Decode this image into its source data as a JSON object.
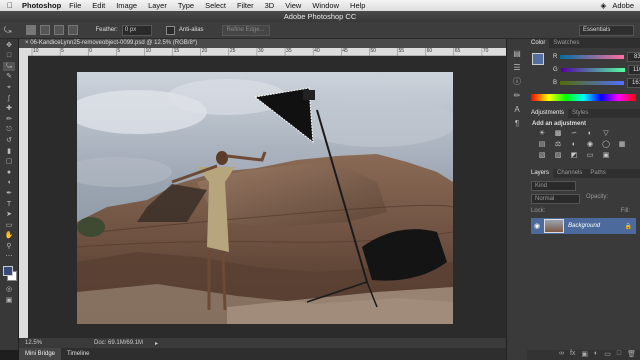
{
  "menubar": {
    "app": "Photoshop",
    "items": [
      "File",
      "Edit",
      "Image",
      "Layer",
      "Type",
      "Select",
      "Filter",
      "3D",
      "View",
      "Window",
      "Help"
    ],
    "right_label": "Adobe"
  },
  "window": {
    "title": "Adobe Photoshop CC"
  },
  "options": {
    "feather_label": "Feather:",
    "feather_value": "0 px",
    "antialias_label": "Anti-alias",
    "refine_label": "Refine Edge...",
    "workspace": "Essentials"
  },
  "document": {
    "tab_title": "06-KandiceLynn25-removeobject-0099.psd @ 12.5% (RGB/8*)",
    "zoom": "12.5%",
    "doc_size": "Doc: 69.1M/69.1M"
  },
  "ruler": {
    "labels": [
      "10",
      "5",
      "0",
      "5",
      "10",
      "15",
      "20",
      "25",
      "30",
      "35",
      "40",
      "45",
      "50",
      "55",
      "60",
      "65",
      "70"
    ]
  },
  "bottom_tabs": [
    "Mini Bridge",
    "Timeline"
  ],
  "color_panel": {
    "tabs": [
      "Color",
      "Swatches"
    ],
    "channels": [
      {
        "label": "R",
        "value": "83"
      },
      {
        "label": "G",
        "value": "110"
      },
      {
        "label": "B",
        "value": "161"
      }
    ],
    "foreground": "#536ea1"
  },
  "adjustments_panel": {
    "tabs": [
      "Adjustments",
      "Styles"
    ],
    "heading": "Add an adjustment"
  },
  "layers_panel": {
    "tabs": [
      "Layers",
      "Channels",
      "Paths"
    ],
    "kind": "Kind",
    "blend_mode": "Normal",
    "opacity_label": "Opacity:",
    "lock_label": "Lock:",
    "fill_label": "Fill:",
    "layer_name": "Background"
  }
}
